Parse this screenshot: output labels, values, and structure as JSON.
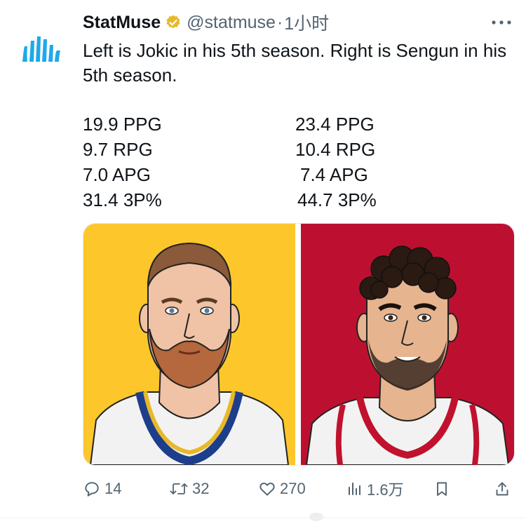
{
  "colors": {
    "text_primary": "#0f1419",
    "text_secondary": "#536471",
    "brand_logo": "#1ea9e8",
    "verified_badge": "#e8b829",
    "jokic_background": "#fdc72c",
    "sengun_background": "#bd1030"
  },
  "tweet": {
    "author": {
      "display_name": "StatMuse",
      "handle": "@statmuse",
      "separator": "·",
      "time": "1小时",
      "avatar_icon": "statmuse-logo",
      "verified_icon": "gold-verified-badge"
    },
    "text": "Left is Jokic in his 5th season. Right is Sengun in his 5th season.",
    "stats": [
      {
        "left": "19.9 PPG",
        "right": "23.4 PPG"
      },
      {
        "left": "9.7 RPG",
        "right": "10.4 RPG"
      },
      {
        "left": "7.0 APG",
        "right": "7.4 APG"
      },
      {
        "left": "31.4 3P%",
        "right": "44.7 3P%"
      }
    ],
    "media": {
      "left_image": "jokic-illustration",
      "right_image": "sengun-illustration"
    },
    "actions": {
      "replies": "14",
      "retweets": "32",
      "likes": "270",
      "views": "1.6万"
    }
  }
}
